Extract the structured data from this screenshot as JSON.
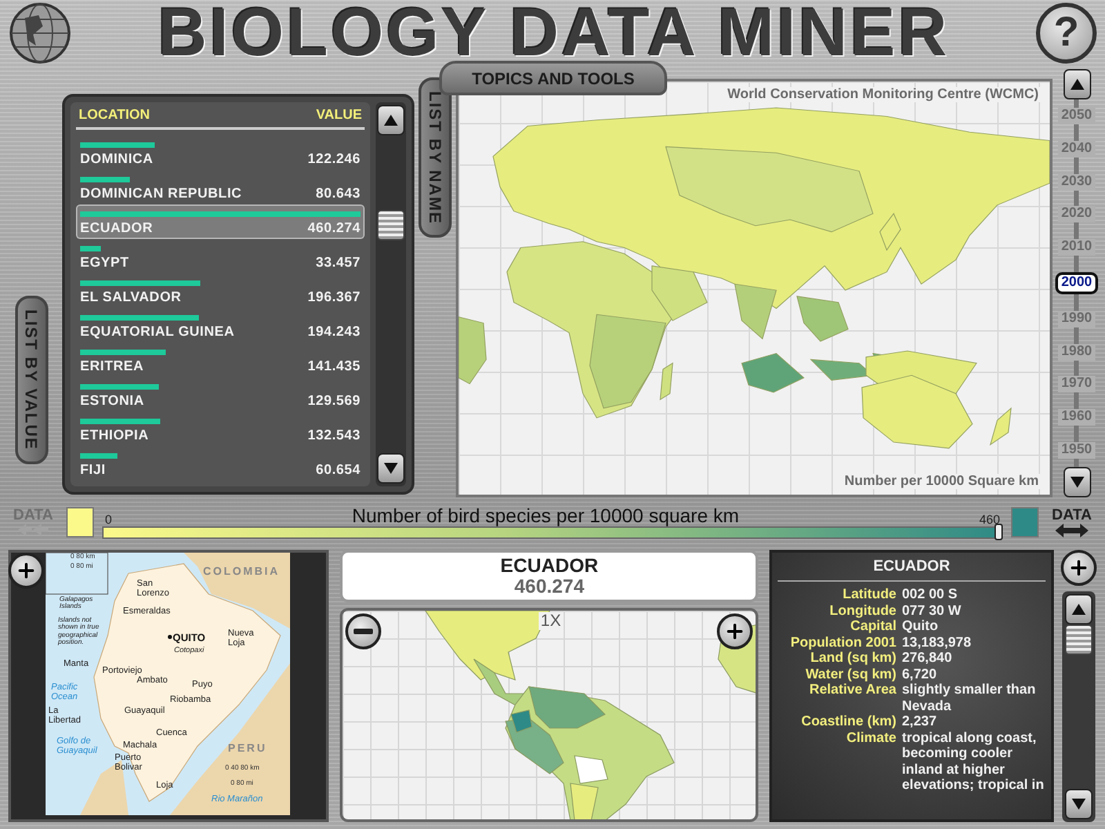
{
  "app": {
    "title": "BIOLOGY DATA MINER",
    "help_label": "?"
  },
  "topics_tab": {
    "label": "TOPICS AND TOOLS"
  },
  "list_tabs": [
    "LIST BY VALUE",
    "LIST BY NAME"
  ],
  "list": {
    "columns": [
      "LOCATION",
      "VALUE"
    ],
    "rows": [
      {
        "name": "DOMINICA",
        "value": "122.246",
        "level": 0.266,
        "selected": false
      },
      {
        "name": "DOMINICAN REPUBLIC",
        "value": "80.643",
        "level": 0.175,
        "selected": false
      },
      {
        "name": "ECUADOR",
        "value": "460.274",
        "level": 1,
        "selected": true
      },
      {
        "name": "EGYPT",
        "value": "33.457",
        "level": 0.073,
        "selected": false
      },
      {
        "name": "EL SALVADOR",
        "value": "196.367",
        "level": 0.427,
        "selected": false
      },
      {
        "name": "EQUATORIAL GUINEA",
        "value": "194.243",
        "level": 0.422,
        "selected": false
      },
      {
        "name": "ERITREA",
        "value": "141.435",
        "level": 0.307,
        "selected": false
      },
      {
        "name": "ESTONIA",
        "value": "129.569",
        "level": 0.281,
        "selected": false
      },
      {
        "name": "ETHIOPIA",
        "value": "132.543",
        "level": 0.288,
        "selected": false
      },
      {
        "name": "FIJI",
        "value": "60.654",
        "level": 0.132,
        "selected": false
      }
    ]
  },
  "map": {
    "source": "World Conservation Monitoring Centre (WCMC)",
    "unit": "Number per 10000 Square km"
  },
  "timeline": {
    "years": [
      {
        "label": "2050",
        "selected": false
      },
      {
        "label": "2040",
        "selected": false
      },
      {
        "label": "2030",
        "selected": false
      },
      {
        "label": "2020",
        "selected": false
      },
      {
        "label": "2010",
        "selected": false
      },
      {
        "label": "2000",
        "selected": true
      },
      {
        "label": "1990",
        "selected": false
      },
      {
        "label": "1980",
        "selected": false
      },
      {
        "label": "1970",
        "selected": false
      },
      {
        "label": "1960",
        "selected": false
      },
      {
        "label": "1950",
        "selected": false
      }
    ]
  },
  "legend": {
    "back_label": "DATA",
    "back_disabled": true,
    "forward_label": "DATA",
    "forward_disabled": false,
    "title": "Number of bird species per 10000 square km",
    "min": "0",
    "max": "460",
    "level": 1
  },
  "country_map": {
    "labels": [
      {
        "text": "0 80 km",
        "kind": "scale"
      },
      {
        "text": "0 80 mi",
        "kind": "scale"
      },
      {
        "text": "San Lorenzo",
        "kind": "city"
      },
      {
        "text": "Esmeraldas",
        "kind": "city"
      },
      {
        "text": "COLOMBIA",
        "kind": "country"
      },
      {
        "text": "QUITO",
        "kind": "capital"
      },
      {
        "text": "Cotopaxi",
        "kind": "peak"
      },
      {
        "text": "Nueva Loja",
        "kind": "city"
      },
      {
        "text": "Galapagos Islands",
        "kind": "note"
      },
      {
        "text": "Islands not shown in true geographical position.",
        "kind": "note"
      },
      {
        "text": "Manta",
        "kind": "city"
      },
      {
        "text": "Portoviejo",
        "kind": "city"
      },
      {
        "text": "Ambato",
        "kind": "city"
      },
      {
        "text": "Puyo",
        "kind": "city"
      },
      {
        "text": "Pacific Ocean",
        "kind": "water"
      },
      {
        "text": "Riobamba",
        "kind": "city"
      },
      {
        "text": "La Libertad",
        "kind": "city"
      },
      {
        "text": "Guayaquil",
        "kind": "city"
      },
      {
        "text": "Cuenca",
        "kind": "city"
      },
      {
        "text": "Golfo de Guayaquil",
        "kind": "water"
      },
      {
        "text": "Machala",
        "kind": "city"
      },
      {
        "text": "Puerto Bolivar",
        "kind": "city"
      },
      {
        "text": "PERU",
        "kind": "country"
      },
      {
        "text": "0 40 80 km",
        "kind": "scale"
      },
      {
        "text": "0 80 mi",
        "kind": "scale"
      },
      {
        "text": "Loja",
        "kind": "city"
      },
      {
        "text": "Rio Marañon",
        "kind": "water"
      }
    ]
  },
  "detail": {
    "name": "ECUADOR",
    "value": "460.274",
    "zoom": "1X"
  },
  "facts": {
    "title": "ECUADOR",
    "rows": [
      {
        "label": "Latitude",
        "value": "002 00 S"
      },
      {
        "label": "Longitude",
        "value": "077 30 W"
      },
      {
        "label": "Capital",
        "value": "Quito"
      },
      {
        "label": "Population 2001",
        "value": "13,183,978"
      },
      {
        "label": "Land (sq km)",
        "value": "276,840"
      },
      {
        "label": "Water (sq km)",
        "value": "6,720"
      },
      {
        "label": "Relative Area",
        "value": "slightly smaller than Nevada"
      },
      {
        "label": "Coastline (km)",
        "value": "2,237"
      },
      {
        "label": "Climate",
        "value": "tropical along coast, becoming cooler inland at higher elevations; tropical in"
      }
    ]
  }
}
